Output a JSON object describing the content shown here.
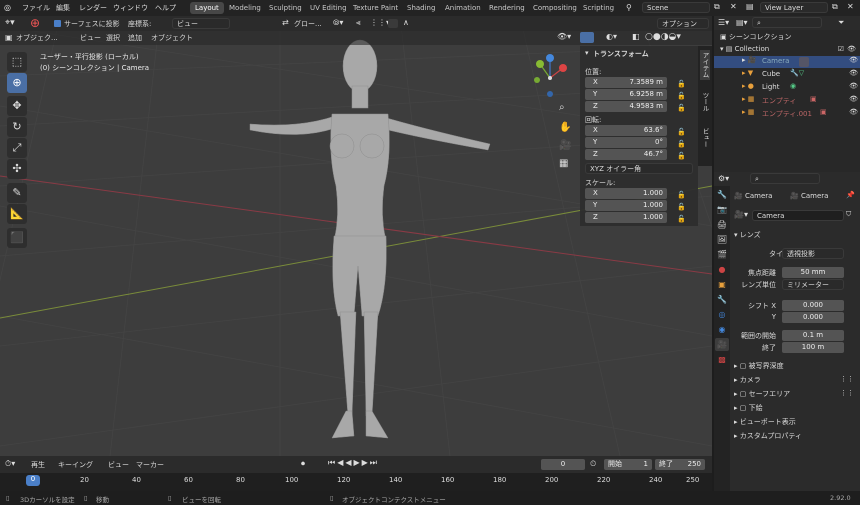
{
  "menubar": {
    "items": [
      "ファイル",
      "編集",
      "レンダー",
      "ウィンドウ",
      "ヘルプ"
    ],
    "workspaces": [
      "Layout",
      "Modeling",
      "Sculpting",
      "UV Editing",
      "Texture Paint",
      "Shading",
      "Animation",
      "Rendering",
      "Compositing",
      "Scripting"
    ],
    "scene": "Scene",
    "view_layer": "View Layer"
  },
  "viewport_header": {
    "snap_surface": "サーフェスに投影",
    "coord_label": "座標系:",
    "coord_value": "ビュー",
    "pivot": "グロー...",
    "options": "オプション"
  },
  "viewport_menu": {
    "mode": "オブジェク...",
    "items": [
      "ビュー",
      "選択",
      "追加",
      "オブジェクト"
    ]
  },
  "overlay": {
    "view_name": "ユーザー・平行投影 (ローカル)",
    "collection": "(0) シーンコレクション | Camera"
  },
  "npanel": {
    "title": "トランスフォーム",
    "location_label": "位置:",
    "location": [
      {
        "axis": "X",
        "value": "7.3589 m"
      },
      {
        "axis": "Y",
        "value": "6.9258 m"
      },
      {
        "axis": "Z",
        "value": "4.9583 m"
      }
    ],
    "rotation_label": "回転:",
    "rotation": [
      {
        "axis": "X",
        "value": "63.6°"
      },
      {
        "axis": "Y",
        "value": "0°"
      },
      {
        "axis": "Z",
        "value": "46.7°"
      }
    ],
    "rotation_mode": "XYZ オイラー角",
    "scale_label": "スケール:",
    "scale": [
      {
        "axis": "X",
        "value": "1.000"
      },
      {
        "axis": "Y",
        "value": "1.000"
      },
      {
        "axis": "Z",
        "value": "1.000"
      }
    ]
  },
  "vtabs": [
    "アイテム",
    "ツール",
    "ビュー"
  ],
  "outliner": {
    "root": "シーンコレクション",
    "collection": "Collection",
    "items": [
      "Camera",
      "Cube",
      "Light",
      "エンプティ",
      "エンプティ.001"
    ]
  },
  "properties": {
    "object": "Camera",
    "data": "Camera",
    "datablock": "Camera",
    "lens_section": "レンズ",
    "type_label": "タイプ",
    "type_value": "透視投影",
    "focal_label": "焦点距離",
    "focal_value": "50 mm",
    "unit_label": "レンズ単位",
    "unit_value": "ミリメーター",
    "shiftx_label": "シフト X",
    "shiftx_value": "0.000",
    "shifty_label": "Y",
    "shifty_value": "0.000",
    "clip_start_label": "範囲の開始",
    "clip_start_value": "0.1 m",
    "clip_end_label": "終了",
    "clip_end_value": "100 m",
    "sections": [
      "被写界深度",
      "カメラ",
      "セーフエリア",
      "下絵",
      "ビューポート表示",
      "カスタムプロパティ"
    ]
  },
  "timeline": {
    "menu": [
      "再生",
      "キーイング",
      "ビュー",
      "マーカー"
    ],
    "current": "0",
    "start_label": "開始",
    "start": "1",
    "end_label": "終了",
    "end": "250",
    "ticks": [
      "0",
      "20",
      "40",
      "60",
      "80",
      "100",
      "120",
      "140",
      "160",
      "180",
      "200",
      "220",
      "240",
      "250"
    ]
  },
  "statusbar": {
    "left": "3Dカーソルを設定",
    "move": "移動",
    "rotate": "ビューを回転",
    "context": "オブジェクトコンテクストメニュー",
    "version": "2.92.0"
  }
}
